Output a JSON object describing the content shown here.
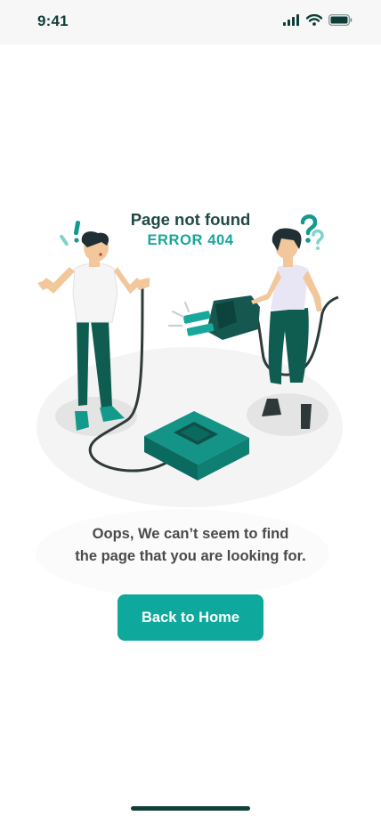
{
  "status_bar": {
    "time": "9:41",
    "icons": [
      "signal-icon",
      "wifi-icon",
      "battery-icon"
    ]
  },
  "illustration": {
    "title": "Page not found",
    "code": "ERROR 404"
  },
  "message": {
    "line1": "Oops, We can’t seem to find",
    "line2": "the page that you are looking for."
  },
  "button": {
    "label": "Back to Home"
  },
  "colors": {
    "accent": "#0fa89d",
    "dark_green": "#0c5a4f",
    "text": "#4a4a4a",
    "status_text": "#0f3d38"
  }
}
